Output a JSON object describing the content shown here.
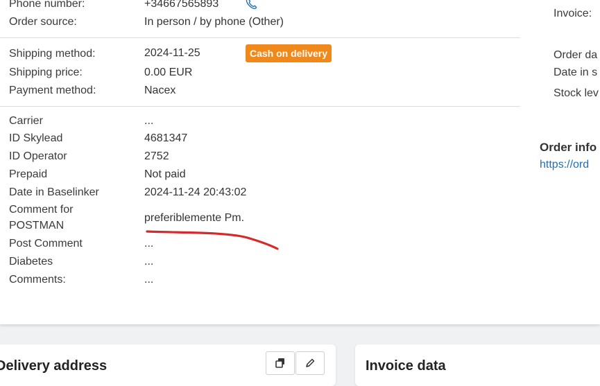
{
  "order_details": {
    "phone": {
      "label": "Phone number:",
      "value": "+34667565893"
    },
    "order_source": {
      "label": "Order source:",
      "value": "In person / by phone (Other)"
    },
    "shipping_method": {
      "label": "Shipping method:",
      "value": "2024-11-25",
      "badge": "Cash on delivery"
    },
    "shipping_price": {
      "label": "Shipping price:",
      "value": "0.00 EUR"
    },
    "payment_method": {
      "label": "Payment method:",
      "value": "Nacex"
    },
    "carrier": {
      "label": "Carrier",
      "value": "..."
    },
    "id_skylead": {
      "label": "ID Skylead",
      "value": "4681347"
    },
    "id_operator": {
      "label": "ID Operator",
      "value": "2752"
    },
    "prepaid": {
      "label": "Prepaid",
      "value": "Not paid"
    },
    "date_in_baselinker": {
      "label": "Date in Baselinker",
      "value": "2024-11-24 20:43:02"
    },
    "comment_for_postman": {
      "label_line1": "Comment for",
      "label_line2": "POSTMAN",
      "value": "preferiblemente Pm."
    },
    "post_comment": {
      "label": "Post Comment",
      "value": "..."
    },
    "diabetes": {
      "label": "Diabetes",
      "value": "..."
    },
    "comments": {
      "label": "Comments:",
      "value": "..."
    }
  },
  "right_panel": {
    "invoice_label": "Invoice:",
    "order_date_label": "Order da",
    "date_in_label": "Date in s",
    "stock_level_label": "Stock lev",
    "order_info_label": "Order info",
    "order_info_link": "https://ord"
  },
  "cards": {
    "delivery_title": "Delivery address",
    "invoice_title": "Invoice data"
  },
  "colors": {
    "badge": "#f0891b",
    "link": "#1f6fb5",
    "annotation": "#d42a2a"
  },
  "icons": {
    "phone": "phone-icon",
    "copy": "copy-icon",
    "edit": "pencil-icon"
  }
}
